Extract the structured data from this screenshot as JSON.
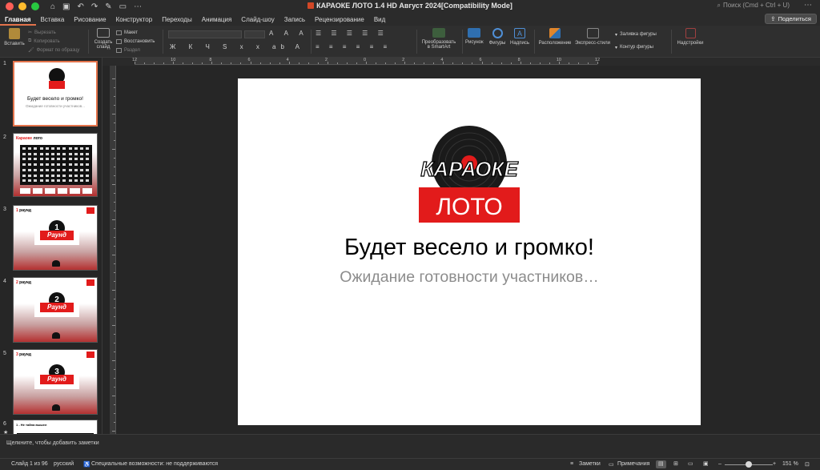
{
  "window": {
    "title": "КАРАОКЕ ЛОТО 1.4 HD Август 2024[Compatibility Mode]",
    "search_placeholder": "Поиск (Cmd + Ctrl + U)",
    "share_label": "Поделиться"
  },
  "tabs": [
    {
      "label": "Главная",
      "active": true
    },
    {
      "label": "Вставка"
    },
    {
      "label": "Рисование"
    },
    {
      "label": "Конструктор"
    },
    {
      "label": "Переходы"
    },
    {
      "label": "Анимация"
    },
    {
      "label": "Слайд-шоу"
    },
    {
      "label": "Запись"
    },
    {
      "label": "Рецензирование"
    },
    {
      "label": "Вид"
    }
  ],
  "ribbon": {
    "paste": "Вставить",
    "cut": "Вырезать",
    "copy": "Копировать",
    "format_painter": "Формат по образцу",
    "new_slide_1": "Создать",
    "new_slide_2": "слайд",
    "layout": "Макет",
    "reset": "Восстановить",
    "section": "Раздел",
    "convert_smartart_1": "Преобразовать",
    "convert_smartart_2": "в SmartArt",
    "picture": "Рисунок",
    "shapes": "Фигуры",
    "textbox": "Надпись",
    "arrange": "Расположение",
    "quick_styles": "Экспресс-стили",
    "shape_fill": "Заливка фигуры",
    "shape_outline": "Контур фигуры",
    "addins": "Надстройки"
  },
  "ruler": {
    "numbers": [
      "12",
      "10",
      "8",
      "6",
      "4",
      "2",
      "0",
      "2",
      "4",
      "6",
      "8",
      "10",
      "12"
    ]
  },
  "thumbnails": [
    {
      "num": "1"
    },
    {
      "num": "2",
      "title_red": "Караоке",
      "title_black": " лото"
    },
    {
      "num": "3",
      "title_red": "1",
      "title_black": " раунд",
      "digit": "1",
      "word": "Раунд"
    },
    {
      "num": "4",
      "title_red": "2",
      "title_black": " раунд",
      "digit": "2",
      "word": "Раунд"
    },
    {
      "num": "5",
      "title_red": "3",
      "title_black": " раунд",
      "digit": "3",
      "word": "Раунд"
    },
    {
      "num": "6",
      "title_black": "1 - Не тайна вышел"
    }
  ],
  "thumb1": {
    "title": "Будет весело и громко!",
    "subtitle": "Ожидание готовности участников..."
  },
  "slide": {
    "logo_top": "КАРАОКЕ",
    "logo_bottom": "ЛОТО",
    "title": "Будет весело и громко!",
    "subtitle": "Ожидание готовности участников…"
  },
  "notes": {
    "placeholder": "Щелкните, чтобы добавить заметки"
  },
  "status": {
    "slide_info": "Слайд 1 из 96",
    "language": "русский",
    "accessibility": "Специальные возможности: не поддерживаются",
    "notes_btn": "Заметки",
    "comments_btn": "Примечания",
    "zoom": "151 %"
  },
  "colors": {
    "accent": "#e3734b",
    "logo_red": "#e21b1b",
    "panel_bg": "#2f2f2f"
  }
}
